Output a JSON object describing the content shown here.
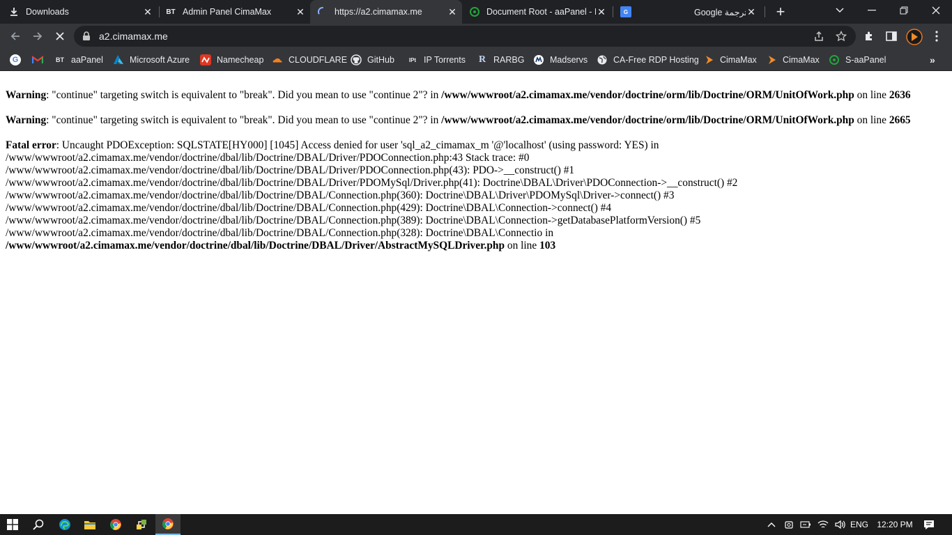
{
  "tabs": [
    {
      "title": "Downloads",
      "icon": "download-icon",
      "active": false
    },
    {
      "title": "Admin Panel CimaMax",
      "icon": "bt-icon",
      "active": false
    },
    {
      "title": "https://a2.cimamax.me",
      "icon": "loading-spinner-icon",
      "active": true
    },
    {
      "title": "Document Root - aaPanel - H",
      "icon": "aapanel-icon",
      "active": false
    },
    {
      "title": "",
      "icon": "google-translate-icon",
      "active": false
    },
    {
      "title": "Google ترجمة",
      "icon": "",
      "active": false
    }
  ],
  "favicon_text": {
    "bt": "BT"
  },
  "toolbar": {
    "url": "a2.cimamax.me"
  },
  "bookmarks": [
    {
      "label": "",
      "icon": "google-icon"
    },
    {
      "label": "",
      "icon": "gmail-icon"
    },
    {
      "label": "aaPanel",
      "icon": "bt-icon",
      "icon_text": "BT"
    },
    {
      "label": "Microsoft Azure",
      "icon": "azure-icon"
    },
    {
      "label": "Namecheap",
      "icon": "namecheap-icon"
    },
    {
      "label": "CLOUDFLARE",
      "icon": "cloudflare-icon"
    },
    {
      "label": "GitHub",
      "icon": "github-icon"
    },
    {
      "label": "IP Torrents",
      "icon": "iptorrents-icon",
      "icon_text": "IPt"
    },
    {
      "label": "RARBG",
      "icon": "rarbg-icon",
      "icon_text": "R"
    },
    {
      "label": "Madservs",
      "icon": "madservs-icon"
    },
    {
      "label": "CA-Free RDP Hosting",
      "icon": "globe-icon"
    },
    {
      "label": "CimaMax",
      "icon": "cimamax-icon"
    },
    {
      "label": "CimaMax",
      "icon": "cimamax-icon"
    },
    {
      "label": "S-aaPanel",
      "icon": "aapanel-icon"
    }
  ],
  "content": {
    "warning1": {
      "label": "Warning",
      "text": ": \"continue\" targeting switch is equivalent to \"break\". Did you mean to use \"continue 2\"? in ",
      "file": "/www/wwwroot/a2.cimamax.me/vendor/doctrine/orm/lib/Doctrine/ORM/UnitOfWork.php",
      "on_line": " on line ",
      "line_no": "2636"
    },
    "warning2": {
      "label": "Warning",
      "text": ": \"continue\" targeting switch is equivalent to \"break\". Did you mean to use \"continue 2\"? in ",
      "file": "/www/wwwroot/a2.cimamax.me/vendor/doctrine/orm/lib/Doctrine/ORM/UnitOfWork.php",
      "on_line": " on line ",
      "line_no": "2665"
    },
    "fatal": {
      "label": "Fatal error",
      "lines": [
        ": Uncaught PDOException: SQLSTATE[HY000] [1045] Access denied for user 'sql_a2_cimamax_m '@'localhost' (using password: YES) in",
        "/www/wwwroot/a2.cimamax.me/vendor/doctrine/dbal/lib/Doctrine/DBAL/Driver/PDOConnection.php:43 Stack trace: #0",
        "/www/wwwroot/a2.cimamax.me/vendor/doctrine/dbal/lib/Doctrine/DBAL/Driver/PDOConnection.php(43): PDO->__construct() #1",
        "/www/wwwroot/a2.cimamax.me/vendor/doctrine/dbal/lib/Doctrine/DBAL/Driver/PDOMySql/Driver.php(41): Doctrine\\DBAL\\Driver\\PDOConnection->__construct() #2",
        "/www/wwwroot/a2.cimamax.me/vendor/doctrine/dbal/lib/Doctrine/DBAL/Connection.php(360): Doctrine\\DBAL\\Driver\\PDOMySql\\Driver->connect() #3",
        "/www/wwwroot/a2.cimamax.me/vendor/doctrine/dbal/lib/Doctrine/DBAL/Connection.php(429): Doctrine\\DBAL\\Connection->connect() #4",
        "/www/wwwroot/a2.cimamax.me/vendor/doctrine/dbal/lib/Doctrine/DBAL/Connection.php(389): Doctrine\\DBAL\\Connection->getDatabasePlatformVersion() #5",
        "/www/wwwroot/a2.cimamax.me/vendor/doctrine/dbal/lib/Doctrine/DBAL/Connection.php(328): Doctrine\\DBAL\\Connectio in"
      ],
      "file": "/www/wwwroot/a2.cimamax.me/vendor/doctrine/dbal/lib/Doctrine/DBAL/Driver/AbstractMySQLDriver.php",
      "on_line": " on line ",
      "line_no": "103"
    }
  },
  "taskbar": {
    "language": "ENG",
    "time": "12:20 PM"
  },
  "colors": {
    "tabstrip_bg": "#202124",
    "toolbar_bg": "#35363a",
    "omnibox_bg": "#202124",
    "taskbar_bg": "#1c1c1c",
    "accent_blue": "#8ab4f8"
  }
}
